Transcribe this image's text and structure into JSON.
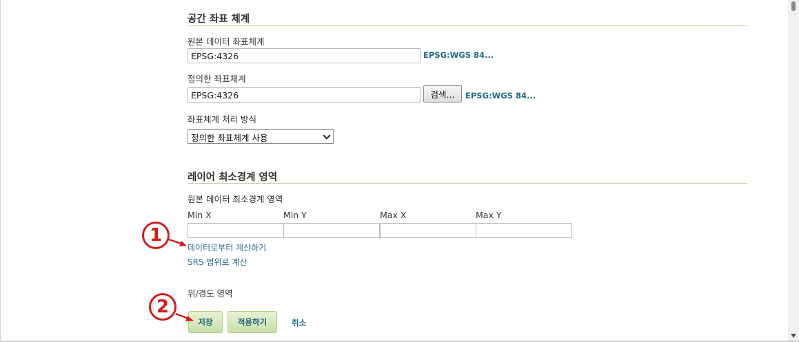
{
  "section_crs": {
    "title": "공간 좌표 체계",
    "native_label": "원본 데이터 좌표체계",
    "native_value": "EPSG:4326",
    "native_link": "EPSG:WGS 84...",
    "declared_label": "정의한 좌표체계",
    "declared_value": "EPSG:4326",
    "search_button": "검색...",
    "declared_link": "EPSG:WGS 84...",
    "handling_label": "좌표체계 처리 방식",
    "handling_selected": "정의한 좌표체계 사용"
  },
  "section_bbox": {
    "title": "레이어 최소경계 영역",
    "native_label": "원본 데이터 최소경계 영역",
    "columns": [
      "Min X",
      "Min Y",
      "Max X",
      "Max Y"
    ],
    "values": [
      "",
      "",
      "",
      ""
    ],
    "compute_from_data": "데이터로부터 계산하기",
    "compute_from_srs": "SRS 범위로 계산",
    "latlon_label": "위/경도 영역"
  },
  "actions": {
    "save": "저장",
    "apply": "적용하기",
    "cancel": "취소"
  },
  "markers": {
    "one": "1",
    "two": "2"
  },
  "colors": {
    "annotation_red": "#d21c1c",
    "link_blue": "#2a6f8a",
    "section_rule": "#c9d8a6",
    "button_green": "#d3e7b6"
  }
}
